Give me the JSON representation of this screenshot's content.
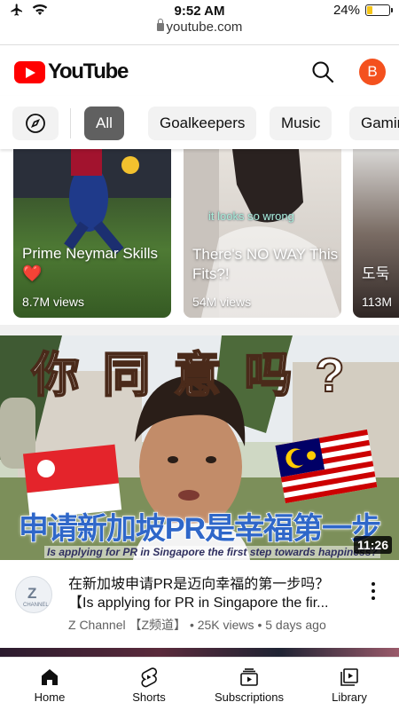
{
  "status_bar": {
    "time": "9:52 AM",
    "battery": "24%",
    "battery_level": 0.24
  },
  "browser": {
    "url": "youtube.com"
  },
  "header": {
    "logo_text": "YouTube",
    "avatar_letter": "B",
    "avatar_color": "#f4511e",
    "brand_red": "#ff0000"
  },
  "chips": {
    "explore_icon": "compass-icon",
    "items": [
      "All",
      "Goalkeepers",
      "Music",
      "Gaming"
    ],
    "active_index": 0
  },
  "shorts": [
    {
      "title": "Prime Neymar Skills",
      "emoji": "❤️",
      "views": "8.7M views"
    },
    {
      "title": "There's NO WAY This Fits?!",
      "overlay": "it looks so wrong",
      "views": "54M views"
    },
    {
      "title": "도둑",
      "views": "113M"
    }
  ],
  "video": {
    "thumbnail_heading": "你同意吗?",
    "thumbnail_banner": "申请新加坡PR是幸福第一步",
    "thumbnail_caption": "Is applying for PR in Singapore the first step towards happiness?",
    "duration": "11:26",
    "title": "在新加坡申请PR是迈向幸福的第一步吗？【Is applying for PR in Singapore the fir...",
    "channel": "Z Channel 【Z频道】",
    "views": "25K views",
    "age": "5 days ago",
    "channel_avatar_text": "Z",
    "channel_avatar_sub": "CHANNEL"
  },
  "bottom_nav": [
    {
      "label": "Home",
      "icon": "home-icon"
    },
    {
      "label": "Shorts",
      "icon": "shorts-icon"
    },
    {
      "label": "Subscriptions",
      "icon": "subscriptions-icon"
    },
    {
      "label": "Library",
      "icon": "library-icon"
    }
  ]
}
